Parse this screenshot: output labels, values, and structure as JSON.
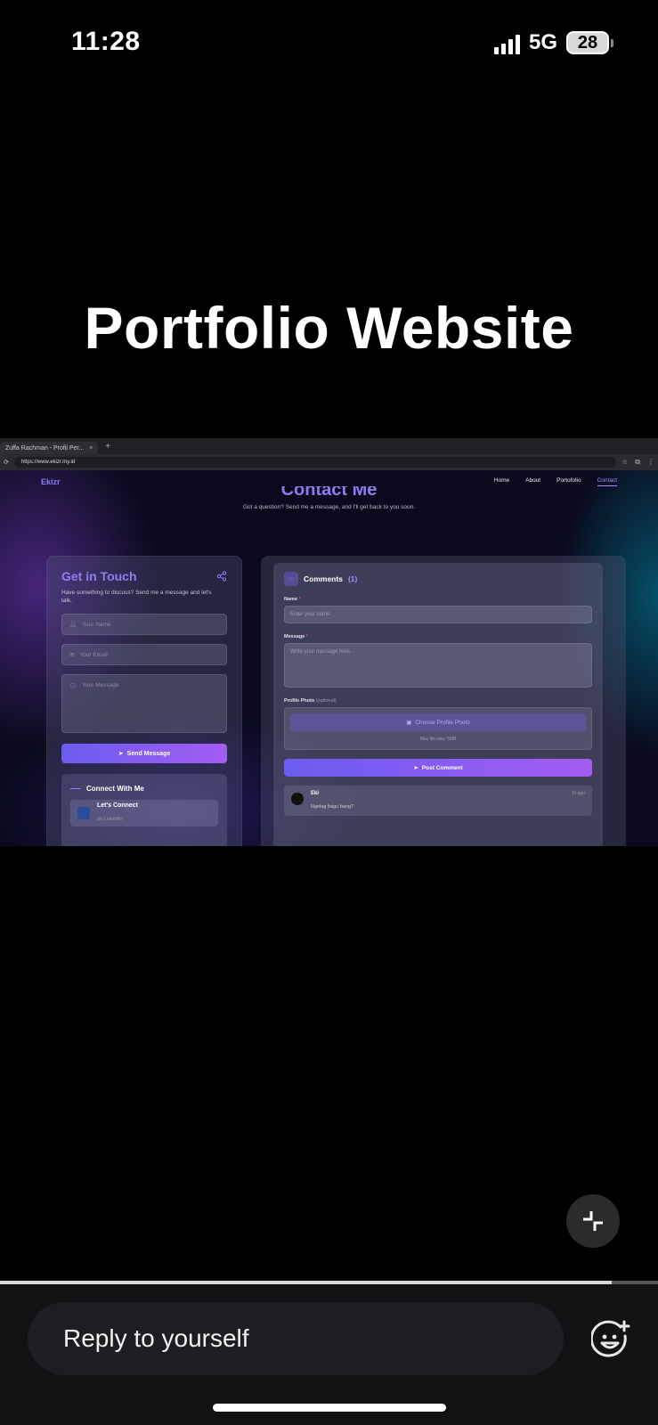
{
  "status_bar": {
    "time": "11:28",
    "network": "5G",
    "battery": "28"
  },
  "story": {
    "title": "Portfolio Website"
  },
  "browser": {
    "tab_title": "Zuffa Rachman - Profil Per...",
    "tab_close": "×",
    "new_tab": "+",
    "url": "https://www.ekizr.my.id"
  },
  "site": {
    "logo": "Ekizr",
    "nav": [
      "Home",
      "About",
      "Portofolio",
      "Contact"
    ],
    "section_title": "Contact Me",
    "section_subtitle": "Got a question? Send me a message, and I'll get back to you soon."
  },
  "contact_form": {
    "title": "Get in Touch",
    "description": "Have something to discuss? Send me a message and let's talk.",
    "name_placeholder": "Your Name",
    "email_placeholder": "Your Email",
    "message_placeholder": "Your Message",
    "send_label": "Send Message"
  },
  "connect": {
    "title": "Connect With Me",
    "item_title": "Let's Connect",
    "item_sub": "on LinkedIn"
  },
  "comments": {
    "title": "Comments",
    "count": "(1)",
    "name_label": "Name",
    "name_placeholder": "Enter your name",
    "message_label": "Message",
    "message_placeholder": "Write your message here...",
    "photo_label": "Profile Photo",
    "photo_optional": "(optional)",
    "choose_photo": "Choose Profile Photo",
    "max_size": "Max file size: 5MB",
    "post_label": "Post Comment",
    "entries": [
      {
        "author": "Eki",
        "text": "Ngelag bagu bang?",
        "time": "1h ago"
      }
    ]
  },
  "reply": {
    "placeholder": "Reply to yourself"
  },
  "progress": {
    "fraction": 0.93
  },
  "icons": [
    "signal-icon",
    "battery-icon",
    "collapse-icon",
    "emoji-add-icon",
    "share-icon",
    "user-icon",
    "mail-icon",
    "chat-icon",
    "send-icon",
    "image-icon"
  ]
}
